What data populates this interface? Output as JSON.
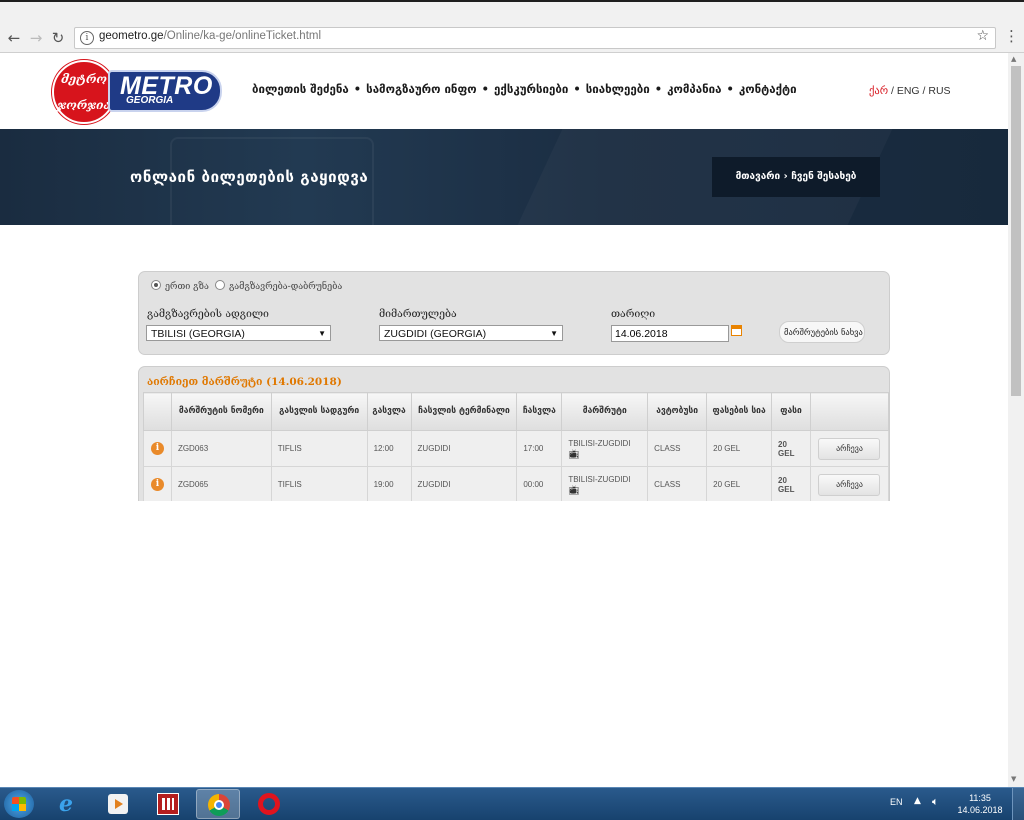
{
  "browser": {
    "url_host": "geometro.ge",
    "url_path": "/Online/ka-ge/onlineTicket.html",
    "back_icon": "arrow-left-icon",
    "forward_icon": "arrow-right-icon",
    "reload_icon": "reload-icon"
  },
  "header": {
    "logo_text": "METRO",
    "logo_sub": "GEORGIA",
    "logo_script": "მეტრო ჯორჯია",
    "nav": [
      "ბილეთის შეძენა",
      "სამოგზაურო ინფო",
      "ექსკურსიები",
      "სიახლეები",
      "კომპანია",
      "კონტაქტი"
    ],
    "nav_sep": "•",
    "lang_ka": "ქარ",
    "lang_sep": "/",
    "lang_en": "ENG",
    "lang_ru": "RUS"
  },
  "hero": {
    "title": "ონლაინ ბილეთების გაყიდვა",
    "crumb_home": "მთავარი",
    "crumb_sep": "›",
    "crumb_current": "ჩვენ შესახებ"
  },
  "search": {
    "radio_oneway": "ერთი გზა",
    "radio_return": "გამგზავრება-დაბრუნება",
    "from_label": "გამგზავრების ადგილი",
    "from_value": "TBILISI (GEORGIA)",
    "to_label": "მიმართულება",
    "to_value": "ZUGDIDI (GEORGIA)",
    "date_label": "თარიღი",
    "date_value": "14.06.2018",
    "button": "მარშრუტების ნახვა"
  },
  "results": {
    "title": "აირჩიეთ მარშრუტი (14.06.2018)",
    "headers": [
      "",
      "მარშრუტის ნომერი",
      "გასვლის სადგური",
      "გასვლა",
      "ჩასვლის ტერმინალი",
      "ჩასვლა",
      "მარშრუტი",
      "ავტობუსი",
      "ფასების სია",
      "ფასი",
      ""
    ],
    "rows": [
      {
        "number": "ZGD063",
        "from": "TIFLIS",
        "dep": "12:00",
        "terminal": "ZUGDIDI",
        "arr": "17:00",
        "route": "TBILISI-ZUGDIDI",
        "bus": "CLASS",
        "pricelist": "20 GEL",
        "price_amount": "20",
        "price_cur": "GEL",
        "action": "არჩევა"
      },
      {
        "number": "ZGD065",
        "from": "TIFLIS",
        "dep": "19:00",
        "terminal": "ZUGDIDI",
        "arr": "00:00",
        "route": "TBILISI-ZUGDIDI",
        "bus": "CLASS",
        "pricelist": "20 GEL",
        "price_amount": "20",
        "price_cur": "GEL",
        "action": "არჩევა"
      }
    ]
  },
  "taskbar": {
    "lang": "EN",
    "time": "11:35",
    "date": "14.06.2018"
  },
  "colors": {
    "accent_orange": "#e07800",
    "brand_red": "#d7141c",
    "brand_blue": "#1f3a86",
    "hero_bg": "#1b2d42"
  }
}
